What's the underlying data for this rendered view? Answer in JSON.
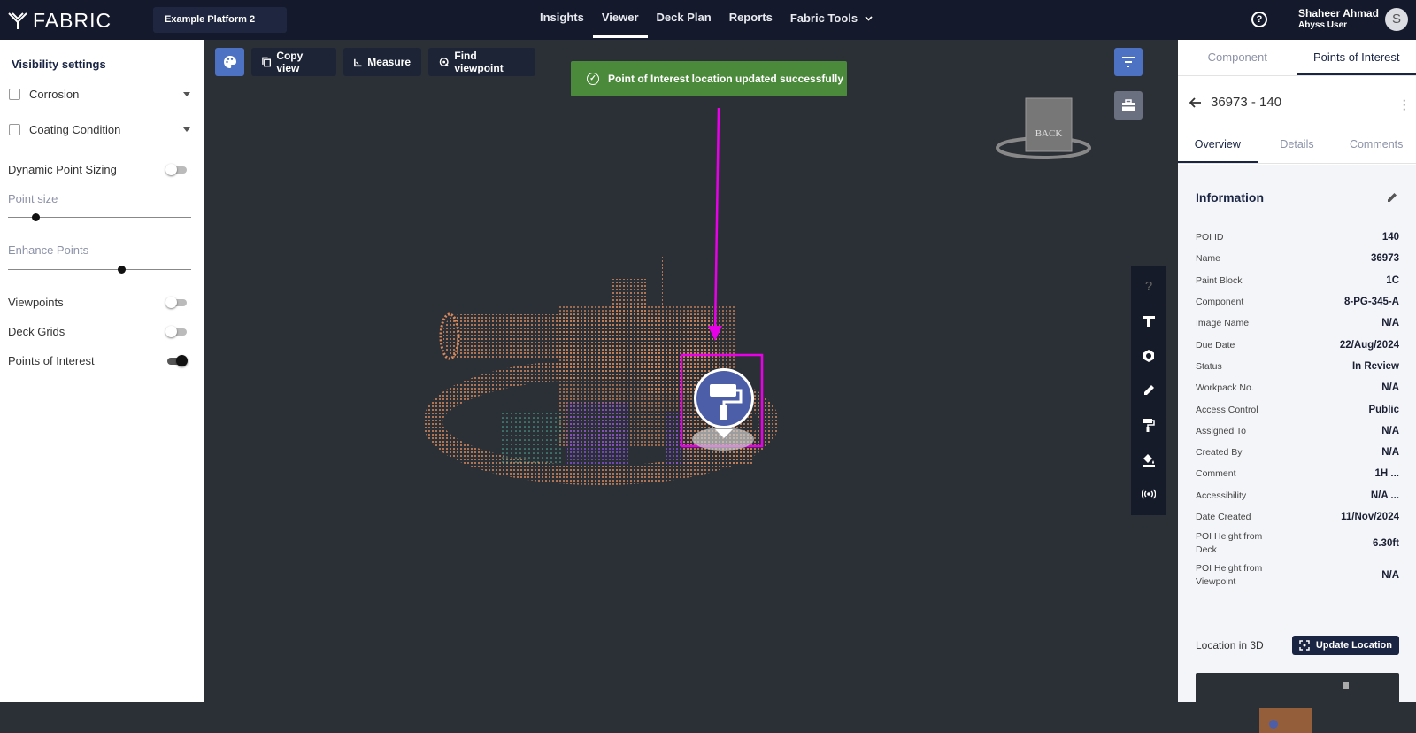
{
  "header": {
    "logo_text": "FABRIC",
    "platform": "Example Platform 2",
    "nav": [
      "Insights",
      "Viewer",
      "Deck Plan",
      "Reports",
      "Fabric Tools"
    ],
    "active_nav": "Viewer",
    "help_label": "?",
    "user_name": "Shaheer Ahmad",
    "user_role": "Abyss User",
    "avatar_initial": "S"
  },
  "sidebar": {
    "title": "Visibility settings",
    "corrosion": "Corrosion",
    "coating": "Coating Condition",
    "dynamic_point": "Dynamic Point Sizing",
    "point_size": "Point size",
    "point_size_value": 0.15,
    "enhance": "Enhance Points",
    "enhance_value": 0.62,
    "viewpoints": "Viewpoints",
    "deck_grids": "Deck Grids",
    "poi": "Points of Interest"
  },
  "toolbar": {
    "copy_view": "Copy view",
    "measure": "Measure",
    "find_viewpoint": "Find viewpoint"
  },
  "toast": "Point of Interest location updated successfully",
  "viewcube": {
    "label": "BACK"
  },
  "panel": {
    "tabs": [
      "Component",
      "Points of Interest"
    ],
    "active_tab": "Points of Interest",
    "poi_title": "36973 - 140",
    "subtabs": [
      "Overview",
      "Details",
      "Comments"
    ],
    "info_title": "Information",
    "rows": [
      {
        "k": "POI ID",
        "v": "140"
      },
      {
        "k": "Name",
        "v": "36973"
      },
      {
        "k": "Paint Block",
        "v": "1C"
      },
      {
        "k": "Component",
        "v": "8-PG-345-A"
      },
      {
        "k": "Image Name",
        "v": "N/A"
      },
      {
        "k": "Due Date",
        "v": "22/Aug/2024"
      },
      {
        "k": "Status",
        "v": "In Review"
      },
      {
        "k": "Workpack No.",
        "v": "N/A"
      },
      {
        "k": "Access Control",
        "v": "Public"
      },
      {
        "k": "Assigned To",
        "v": "N/A"
      },
      {
        "k": "Created By",
        "v": "N/A"
      },
      {
        "k": "Comment",
        "v": "1H ..."
      },
      {
        "k": "Accessibility",
        "v": "N/A ..."
      },
      {
        "k": "Date Created",
        "v": "11/Nov/2024"
      },
      {
        "k": "POI Height from Deck",
        "v": "6.30ft"
      },
      {
        "k": "POI Height from Viewpoint",
        "v": "N/A"
      }
    ],
    "location_label": "Location in 3D",
    "update_button": "Update Location"
  },
  "colors": {
    "accent": "#4d72c4",
    "toast": "#4b8a3a",
    "annotation": "#e800e8",
    "cloud": "#d98a5c",
    "cloud_purple": "#8a4de0"
  }
}
